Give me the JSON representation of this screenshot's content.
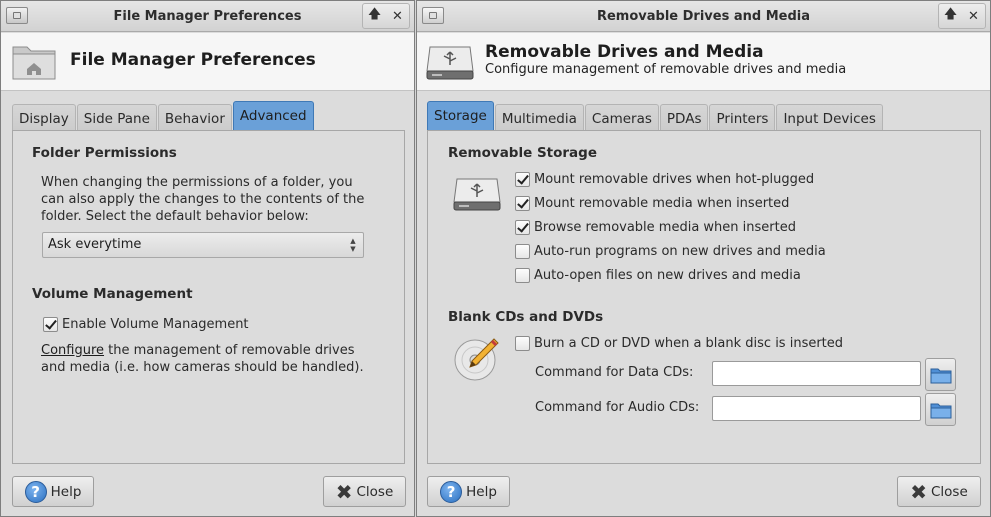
{
  "left_window": {
    "title": "File Manager Preferences",
    "header_title": "File Manager Preferences",
    "tabs": [
      {
        "label": "Display"
      },
      {
        "label": "Side Pane"
      },
      {
        "label": "Behavior"
      },
      {
        "label": "Advanced",
        "active": true
      }
    ],
    "folder_permissions": {
      "title": "Folder Permissions",
      "description_line1": "When changing the permissions of a folder, you",
      "description_line2": "can also apply the changes to the contents of the",
      "description_line3": "folder. Select the default behavior below:",
      "select_value": "Ask everytime"
    },
    "volume_management": {
      "title": "Volume Management",
      "enable_label": "Enable Volume Management",
      "enable_checked": true,
      "configure_link": "Configure",
      "configure_rest_line1": " the management of removable drives",
      "configure_line2": "and media (i.e. how cameras should be handled)."
    },
    "help_label": "Help",
    "close_label": "Close"
  },
  "right_window": {
    "title": "Removable Drives and Media",
    "header_title": "Removable Drives and Media",
    "header_subtitle": "Configure management of removable drives and media",
    "tabs": [
      {
        "label": "Storage",
        "active": true
      },
      {
        "label": "Multimedia"
      },
      {
        "label": "Cameras"
      },
      {
        "label": "PDAs"
      },
      {
        "label": "Printers"
      },
      {
        "label": "Input Devices"
      }
    ],
    "removable_storage": {
      "title": "Removable Storage",
      "options": [
        {
          "label": "Mount removable drives when hot-plugged",
          "checked": true
        },
        {
          "label": "Mount removable media when inserted",
          "checked": true
        },
        {
          "label": "Browse removable media when inserted",
          "checked": true
        },
        {
          "label": "Auto-run programs on new drives and media",
          "checked": false
        },
        {
          "label": "Auto-open files on new drives and media",
          "checked": false
        }
      ]
    },
    "blank_cds": {
      "title": "Blank CDs and DVDs",
      "burn_label": "Burn a CD or DVD when a blank disc is inserted",
      "burn_checked": false,
      "data_cmd_label": "Command for Data CDs:",
      "data_cmd_value": "",
      "audio_cmd_label": "Command for Audio CDs:",
      "audio_cmd_value": ""
    },
    "help_label": "Help",
    "close_label": "Close"
  },
  "titlebar_buttons": {
    "up": "🡅",
    "close": "✕"
  },
  "colors": {
    "active_tab": "#6aa0d8",
    "help_icon": "#2a6fc0"
  }
}
